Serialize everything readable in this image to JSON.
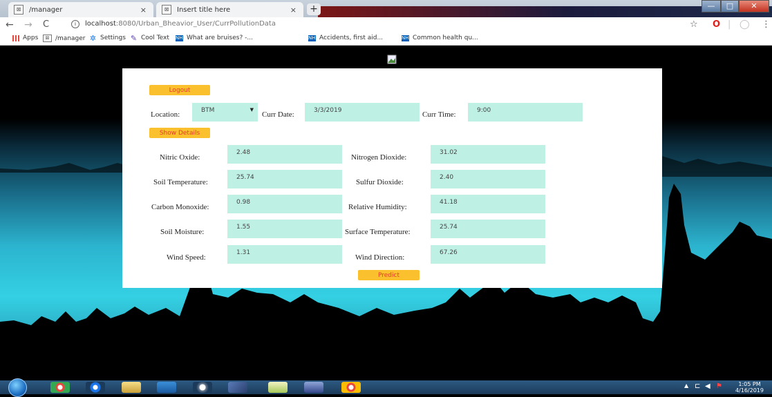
{
  "browser": {
    "tabs": [
      {
        "title": "/manager",
        "close": "×"
      },
      {
        "title": "Insert title here",
        "close": "×"
      }
    ],
    "new_tab": "+",
    "url_host": "localhost",
    "url_path": ":8080/Urban_Bheavior_User/CurrPollutionData",
    "bookmarks": [
      {
        "label": "Apps",
        "icon": "apps-grid-icon"
      },
      {
        "label": "/manager",
        "icon": "tomcat-icon"
      },
      {
        "label": "Settings",
        "icon": "settings-gear-icon"
      },
      {
        "label": "Cool Text",
        "icon": "cooltext-icon"
      },
      {
        "label": "What are bruises? -...",
        "icon": "nhs-icon",
        "icon_text": "NHS"
      },
      {
        "label": "Accidents, first aid...",
        "icon": "nhs-icon",
        "icon_text": "NHS"
      },
      {
        "label": "Common health qu...",
        "icon": "nhs-icon",
        "icon_text": "NHS"
      }
    ],
    "window_controls": {
      "minimize": "—",
      "maximize": "□",
      "close": "✕"
    }
  },
  "form": {
    "logout_label": "Logout",
    "location_label": "Location:",
    "location_value": "BTM",
    "curr_date_label": "Curr Date:",
    "curr_date_value": "3/3/2019",
    "curr_time_label": "Curr Time:",
    "curr_time_value": "9:00",
    "show_details_label": "Show Details",
    "predict_label": "Predict",
    "readings": {
      "nitric_oxide": {
        "label": "Nitric Oxide:",
        "value": "2.48"
      },
      "nitrogen_dioxide": {
        "label": "Nitrogen Dioxide:",
        "value": "31.02"
      },
      "soil_temperature": {
        "label": "Soil Temperature:",
        "value": "25.74"
      },
      "sulfur_dioxide": {
        "label": "Sulfur Dioxide:",
        "value": "2.40"
      },
      "carbon_monoxide": {
        "label": "Carbon Monoxide:",
        "value": "0.98"
      },
      "relative_humidity": {
        "label": "Relative Humidity:",
        "value": "41.18"
      },
      "soil_moisture": {
        "label": "Soil Moisture:",
        "value": "1.55"
      },
      "surface_temperature": {
        "label": "Surface Temperature:",
        "value": "25.74"
      },
      "wind_speed": {
        "label": "Wind Speed:",
        "value": "1.31"
      },
      "wind_direction": {
        "label": "Wind Direction:",
        "value": "67.26"
      }
    }
  },
  "taskbar": {
    "time": "1:05 PM",
    "date": "4/16/2019"
  },
  "colors": {
    "button_bg": "#fbc02d",
    "button_text": "#e8392e",
    "field_bg": "#bff0e4"
  }
}
